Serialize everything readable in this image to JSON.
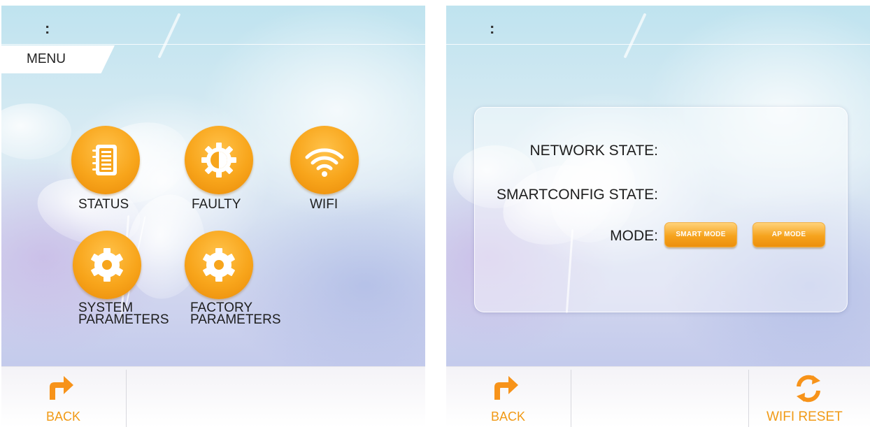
{
  "menu_screen": {
    "header_text": ":",
    "menu_tab_label": "MENU",
    "tiles": [
      {
        "label": "STATUS",
        "icon": "notebook-icon"
      },
      {
        "label": "FAULTY",
        "icon": "half-gear-icon"
      },
      {
        "label": "WIFI",
        "icon": "wifi-icon"
      },
      {
        "label_line1": "SYSTEM",
        "label_line2": "PARAMETERS",
        "icon": "gear-icon"
      },
      {
        "label_line1": "FACTORY",
        "label_line2": "PARAMETERS",
        "icon": "gear-icon"
      }
    ],
    "bottom_bar": {
      "back_label": "BACK",
      "back_icon": "back-arrow-icon"
    }
  },
  "wifi_screen": {
    "header_text": ":",
    "network_state_label": "NETWORK STATE:",
    "smartconfig_state_label": "SMARTCONFIG STATE:",
    "mode_label": "MODE:",
    "smart_mode_button": "SMART MODE",
    "ap_mode_button": "AP MODE",
    "bottom_bar": {
      "back_label": "BACK",
      "back_icon": "back-arrow-icon",
      "wifi_reset_label": "WIFI RESET",
      "wifi_reset_icon": "refresh-icon"
    }
  },
  "colors": {
    "accent_orange": "#f8a51b",
    "label_orange": "#f19a16",
    "text_dark": "#1e1e1e"
  }
}
